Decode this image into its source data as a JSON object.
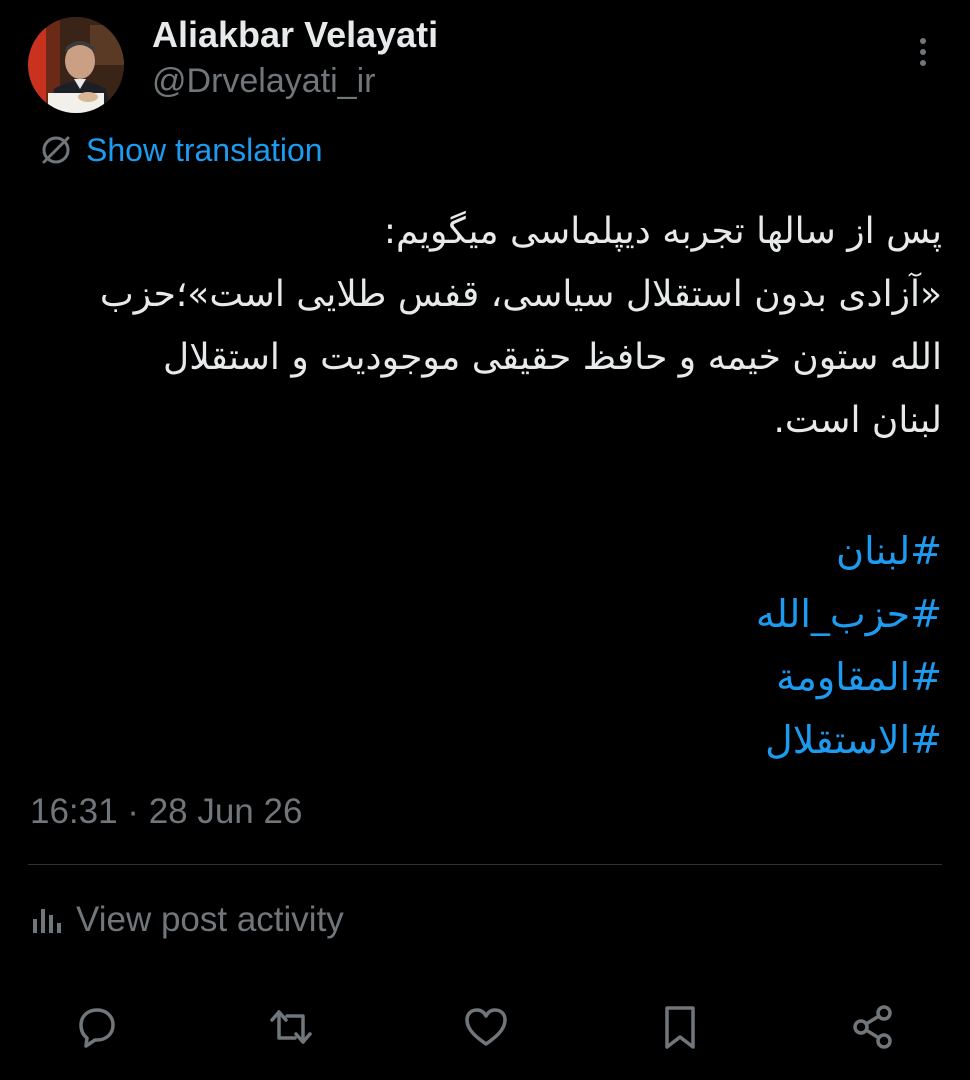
{
  "author": {
    "display_name": "Aliakbar Velayati",
    "handle": "@Drvelayati_ir",
    "avatar_icon": "profile-photo"
  },
  "header": {
    "more_icon": "more-vertical-icon"
  },
  "translation": {
    "icon": "globe-icon",
    "label": "Show translation"
  },
  "post": {
    "lines": [
      "پس از سالها تجربه دیپلماسی میگویم:",
      "«آزادی بدون استقلال سیاسی، قفس طلایی است»؛حزب",
      "الله ستون خیمه و حافظ حقیقی موجودیت و استقلال",
      "لبنان است."
    ],
    "hashtags": [
      "#لبنان",
      "#حزب_الله",
      "#المقاومة",
      "#الاستقلال"
    ],
    "timestamp": "16:31 · 28 Jun 26"
  },
  "activity": {
    "icon": "analytics-icon",
    "label": "View post activity"
  },
  "actions": [
    {
      "name": "reply-button",
      "icon": "reply-icon"
    },
    {
      "name": "repost-button",
      "icon": "repost-icon"
    },
    {
      "name": "like-button",
      "icon": "heart-icon"
    },
    {
      "name": "bookmark-button",
      "icon": "bookmark-icon"
    },
    {
      "name": "share-button",
      "icon": "share-icon"
    }
  ],
  "colors": {
    "background": "#000000",
    "primary_text": "#e7e9ea",
    "secondary_text": "#71767b",
    "accent": "#1d9bf0",
    "divider": "#2f3336"
  }
}
